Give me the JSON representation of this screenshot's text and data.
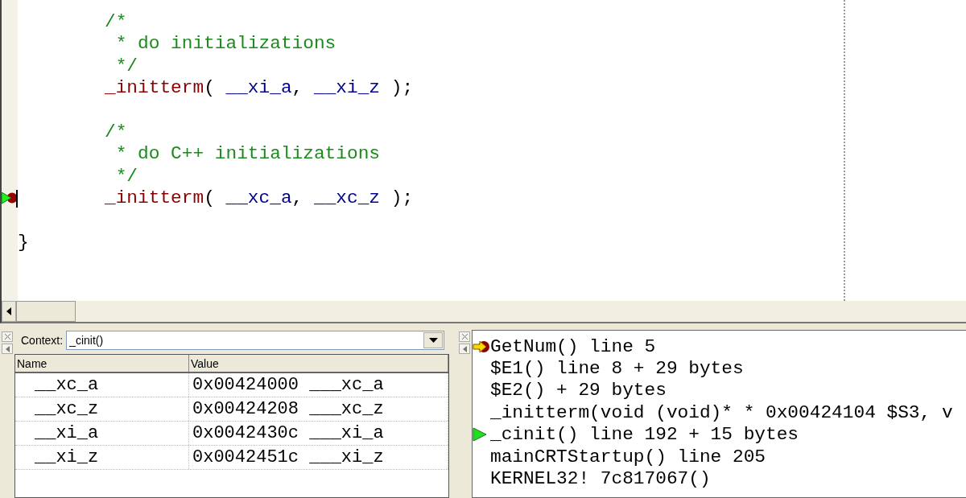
{
  "editor": {
    "lines": [
      {
        "kind": "code",
        "indented": true,
        "breakpoint": false,
        "current": false,
        "segments": [
          {
            "kind": "comment",
            "text": "/*"
          }
        ]
      },
      {
        "kind": "code",
        "indented": true,
        "breakpoint": false,
        "current": false,
        "segments": [
          {
            "kind": "comment",
            "text": " * do initializations"
          }
        ]
      },
      {
        "kind": "code",
        "indented": true,
        "breakpoint": false,
        "current": false,
        "segments": [
          {
            "kind": "comment",
            "text": " */"
          }
        ]
      },
      {
        "kind": "code",
        "indented": true,
        "breakpoint": false,
        "current": false,
        "segments": [
          {
            "kind": "function",
            "text": "_initterm"
          },
          {
            "kind": "plain",
            "text": "( "
          },
          {
            "kind": "variable",
            "text": "__xi_a"
          },
          {
            "kind": "plain",
            "text": ", "
          },
          {
            "kind": "variable",
            "text": "__xi_z"
          },
          {
            "kind": "plain",
            "text": " );"
          }
        ]
      },
      {
        "kind": "blank",
        "breakpoint": false,
        "current": false
      },
      {
        "kind": "code",
        "indented": true,
        "breakpoint": false,
        "current": false,
        "segments": [
          {
            "kind": "comment",
            "text": "/*"
          }
        ]
      },
      {
        "kind": "code",
        "indented": true,
        "breakpoint": false,
        "current": false,
        "segments": [
          {
            "kind": "comment",
            "text": " * do C++ initializations"
          }
        ]
      },
      {
        "kind": "code",
        "indented": true,
        "breakpoint": false,
        "current": false,
        "segments": [
          {
            "kind": "comment",
            "text": " */"
          }
        ]
      },
      {
        "kind": "code",
        "indented": true,
        "breakpoint": true,
        "current": true,
        "segments": [
          {
            "kind": "function",
            "text": "_initterm"
          },
          {
            "kind": "plain",
            "text": "( "
          },
          {
            "kind": "variable",
            "text": "__xc_a"
          },
          {
            "kind": "plain",
            "text": ", "
          },
          {
            "kind": "variable",
            "text": "__xc_z"
          },
          {
            "kind": "plain",
            "text": " );"
          }
        ]
      },
      {
        "kind": "blank",
        "breakpoint": false,
        "current": false
      },
      {
        "kind": "code",
        "indented": false,
        "breakpoint": false,
        "current": false,
        "segments": [
          {
            "kind": "plain",
            "text": "}"
          }
        ]
      }
    ]
  },
  "variables": {
    "context_label": "Context:",
    "context_value": "_cinit()",
    "columns": [
      "Name",
      "Value"
    ],
    "rows": [
      {
        "name": "__xc_a",
        "value": "0x00424000 ___xc_a"
      },
      {
        "name": "__xc_z",
        "value": "0x00424208 ___xc_z"
      },
      {
        "name": "__xi_a",
        "value": "0x0042430c ___xi_a"
      },
      {
        "name": "__xi_z",
        "value": "0x0042451c ___xi_z"
      }
    ]
  },
  "call_stack": {
    "frames": [
      {
        "text": "GetNum() line 5",
        "kind": "current"
      },
      {
        "text": "$E1() line 8 + 29 bytes",
        "kind": "plain"
      },
      {
        "text": "$E2() + 29 bytes",
        "kind": "plain"
      },
      {
        "text": "_initterm(void (void)* * 0x00424104 $S3, v",
        "kind": "plain"
      },
      {
        "text": "_cinit() line 192 + 15 bytes",
        "kind": "caller"
      },
      {
        "text": "mainCRTStartup() line 205",
        "kind": "plain"
      },
      {
        "text": "KERNEL32! 7c817067()",
        "kind": "plain"
      }
    ]
  }
}
